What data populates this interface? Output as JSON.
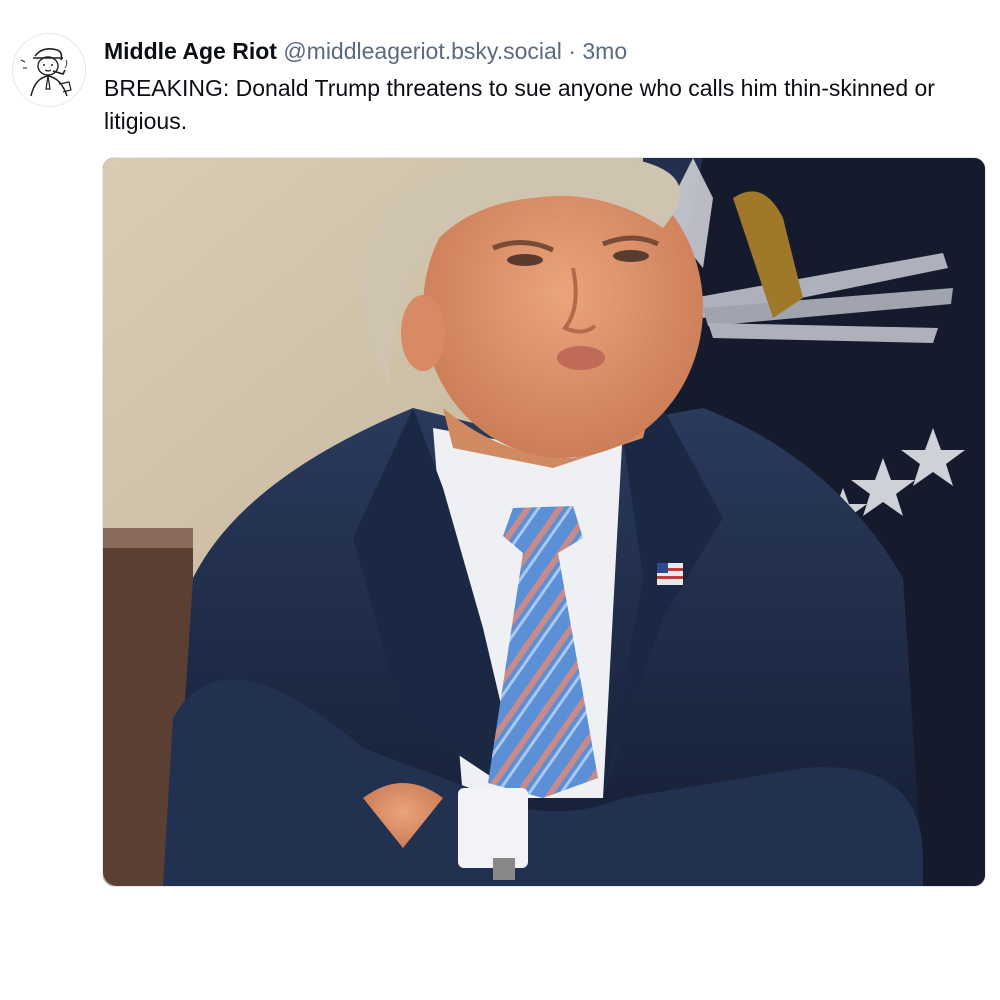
{
  "post": {
    "author": {
      "display_name": "Middle Age Riot",
      "handle": "@middleageriot.bsky.social",
      "separator": "·",
      "timestamp": "3mo",
      "avatar_icon": "vintage-man-illustration-avatar"
    },
    "text": "BREAKING: Donald Trump threatens to sue anyone who calls him thin-skinned or litigious.",
    "media": {
      "type": "photo",
      "subject_icon": "man-arms-crossed-photo"
    }
  },
  "colors": {
    "text_primary": "#0b0f14",
    "text_secondary": "#5b6b7c",
    "suit": "#1f2b45",
    "tie": "#5b8fd6",
    "skin": "#e29a72",
    "flag_background": "#151b2d",
    "wall": "#cdbfa5"
  }
}
